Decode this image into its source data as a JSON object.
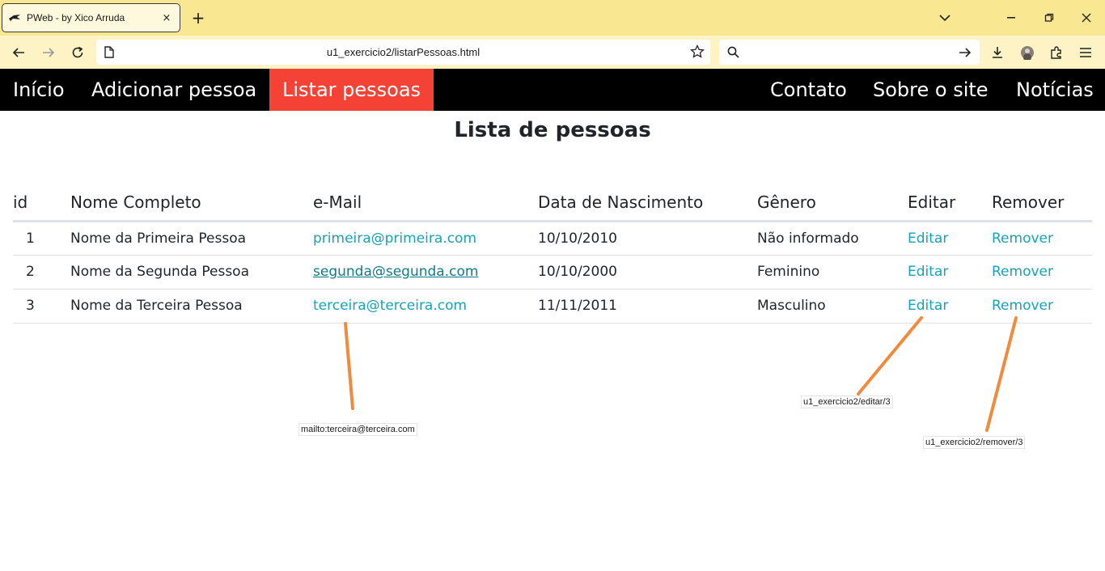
{
  "browser": {
    "tab_title": "PWeb - by Xico Arruda",
    "tab_close_icon": "×",
    "new_tab_icon": "+",
    "url": "u1_exercicio2/listarPessoas.html"
  },
  "site_nav": {
    "left": [
      {
        "label": "Início",
        "active": false
      },
      {
        "label": "Adicionar pessoa",
        "active": false
      },
      {
        "label": "Listar pessoas",
        "active": true
      }
    ],
    "right": [
      {
        "label": "Contato"
      },
      {
        "label": "Sobre o site"
      },
      {
        "label": "Notícias"
      }
    ],
    "active_color": "#f44336"
  },
  "page": {
    "title": "Lista de pessoas"
  },
  "table": {
    "headers": [
      "id",
      "Nome Completo",
      "e-Mail",
      "Data de Nascimento",
      "Gênero",
      "Editar",
      "Remover"
    ],
    "rows": [
      {
        "id": "1",
        "name": "Nome da Primeira Pessoa",
        "email": "primeira@primeira.com",
        "birth": "10/10/2010",
        "gender": "Não informado",
        "edit": "Editar",
        "remove": "Remover"
      },
      {
        "id": "2",
        "name": "Nome da Segunda Pessoa",
        "email": "segunda@segunda.com",
        "birth": "10/10/2000",
        "gender": "Feminino",
        "edit": "Editar",
        "remove": "Remover"
      },
      {
        "id": "3",
        "name": "Nome da Terceira Pessoa",
        "email": "terceira@terceira.com",
        "birth": "11/11/2011",
        "gender": "Masculino",
        "edit": "Editar",
        "remove": "Remover"
      }
    ],
    "link_color": "#17a2b8"
  },
  "annotations": {
    "mailto": "mailto:terceira@terceira.com",
    "edit_url": "u1_exercicio2/editar/3",
    "remove_url": "u1_exercicio2/remover/3",
    "line_color": "#f08a3c"
  }
}
